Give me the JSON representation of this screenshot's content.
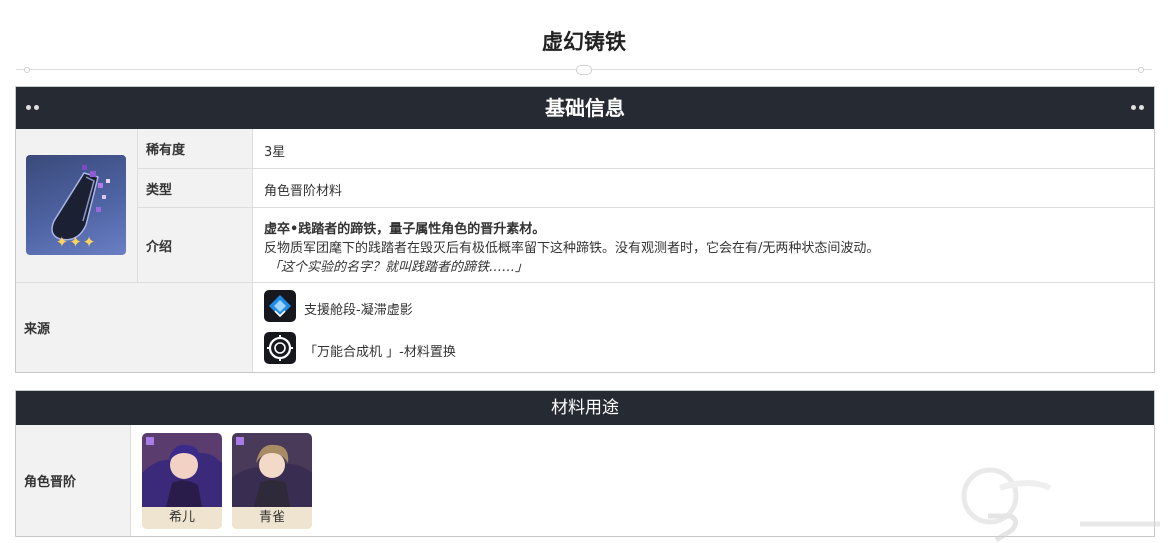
{
  "page": {
    "title": "虚幻铸铁"
  },
  "basic_info": {
    "header": "基础信息",
    "rows": {
      "rarity": {
        "label": "稀有度",
        "value": "3星"
      },
      "type": {
        "label": "类型",
        "value": "角色晋阶材料"
      },
      "intro": {
        "label": "介绍",
        "bold_line": "虚卒•践踏者的蹄铁，量子属性角色的晋升素材。",
        "description": "反物质军团麾下的践踏者在毁灭后有极低概率留下这种蹄铁。没有观测者时，它会在有/无两种状态间波动。",
        "quote": "「这个实验的名字？就叫践踏者的蹄铁……」"
      },
      "source": {
        "label": "来源",
        "items": [
          {
            "text": "支援舱段-凝滞虚影",
            "icon": "blue-diamond-emblem-icon"
          },
          {
            "text": "「万能合成机 」-材料置换",
            "icon": "synthesizer-ring-icon"
          }
        ]
      }
    },
    "item_icon": "iron-horseshoe-icon",
    "stars": "✦✦✦"
  },
  "material_use": {
    "header": "材料用途",
    "row_label": "角色晋阶",
    "characters": [
      {
        "name": "希儿",
        "accent": "#6a3fb0"
      },
      {
        "name": "青雀",
        "accent": "#7a6a4a"
      }
    ]
  },
  "colors": {
    "header_bg": "#262a33",
    "label_bg": "#f2f2f2",
    "border": "#c9c9c9"
  }
}
